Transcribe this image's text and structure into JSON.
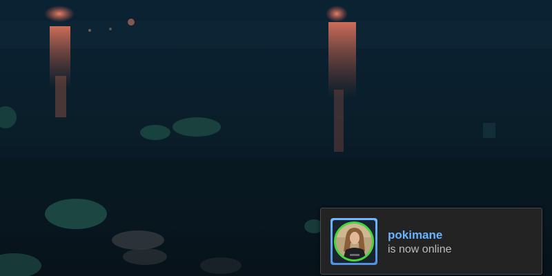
{
  "notification": {
    "persona_name": "pokimane",
    "status_text": "is now online"
  },
  "colors": {
    "name_color": "#6ab4ff",
    "status_color": "#bdbdbd",
    "online_ring": "#43d73b",
    "frame_color": "#5aa2f0"
  },
  "icons": {
    "avatar": "user-avatar"
  }
}
